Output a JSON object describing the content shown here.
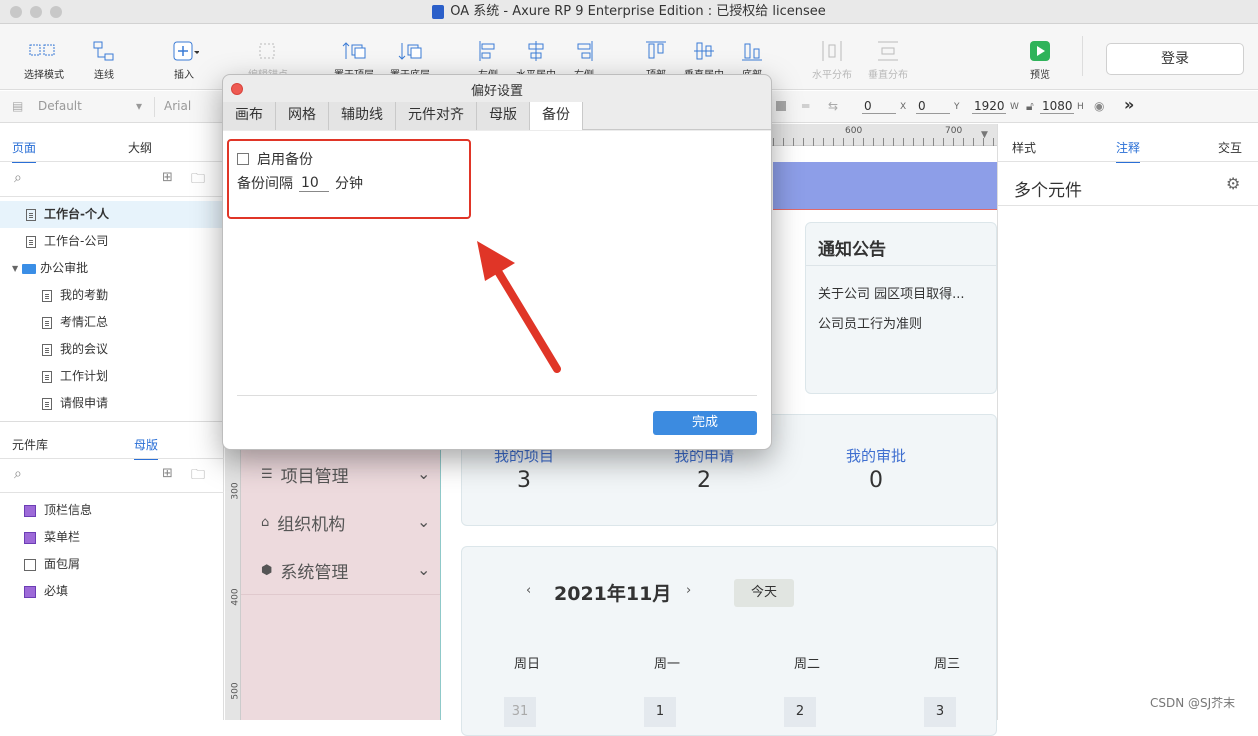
{
  "window": {
    "title": "OA 系统 - Axure RP 9 Enterprise Edition : 已授权给 licensee"
  },
  "toolbar": {
    "select_mode": "选择模式",
    "connect": "连线",
    "insert": "插入",
    "edit_point": "编辑锚点",
    "align_top": "置于顶层",
    "align_bottom": "置于底层",
    "left": "左侧",
    "hcenter": "水平居中",
    "right": "右侧",
    "top": "顶部",
    "vcenter": "垂直居中",
    "bottom": "底部",
    "hdist": "水平分布",
    "vdist": "垂直分布",
    "preview": "预览",
    "login": "登录"
  },
  "format": {
    "style": "Default",
    "font": "Arial",
    "x": "0",
    "y": "0",
    "w": "1920",
    "h": "1080",
    "x_label": "X",
    "y_label": "Y",
    "w_label": "W",
    "h_label": "H"
  },
  "pages": {
    "tab_pages": "页面",
    "tab_outline": "大纲",
    "items": [
      "工作台-个人",
      "工作台-公司",
      "办公审批",
      "我的考勤",
      "考情汇总",
      "我的会议",
      "工作计划",
      "请假申请"
    ]
  },
  "library": {
    "tab_lib": "元件库",
    "tab_master": "母版",
    "masters": [
      "顶栏信息",
      "菜单栏",
      "面包屑",
      "必填"
    ]
  },
  "canvas": {
    "ruler_600": "600",
    "ruler_700": "700",
    "ruler_300": "300",
    "ruler_400": "400",
    "ruler_500": "500",
    "notice_title": "通知公告",
    "notice_1": "关于公司 园区项目取得...",
    "notice_2": "公司员工行为准则",
    "menu": [
      "项目管理",
      "组织机构",
      "系统管理"
    ],
    "stats": [
      {
        "label": "我的项目",
        "value": "3"
      },
      {
        "label": "我的申请",
        "value": "2"
      },
      {
        "label": "我的审批",
        "value": "0"
      }
    ],
    "calendar_title": "2021年11月",
    "today": "今天",
    "weekdays": [
      "周日",
      "周一",
      "周二",
      "周三"
    ],
    "dates": [
      "31",
      "1",
      "2",
      "3"
    ]
  },
  "right": {
    "tab_style": "样式",
    "tab_note": "注释",
    "tab_interact": "交互",
    "heading": "多个元件"
  },
  "dialog": {
    "title": "偏好设置",
    "tabs": [
      "画布",
      "网格",
      "辅助线",
      "元件对齐",
      "母版",
      "备份"
    ],
    "enable_backup": "启用备份",
    "interval_label": "备份间隔",
    "interval_value": "10",
    "interval_unit": "分钟",
    "done": "完成"
  },
  "watermark": "CSDN @SJ芥末",
  "colors": {
    "accent": "#2a6fd6",
    "highlight": "#e03527",
    "close": "#ee5a52"
  }
}
